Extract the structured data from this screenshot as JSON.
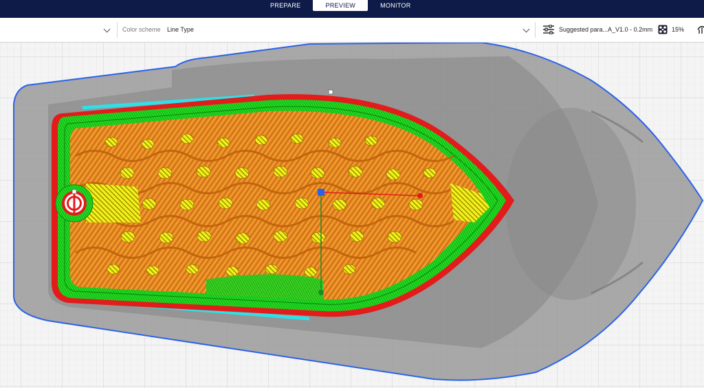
{
  "stage_tabs": {
    "prepare": "PREPARE",
    "preview": "PREVIEW",
    "monitor": "MONITOR"
  },
  "toolbar": {
    "color_scheme_label": "Color scheme",
    "color_scheme_value": "Line Type",
    "print_settings": "Suggested para...A_V1.0 - 0.2mm",
    "infill": "15%"
  },
  "colors": {
    "header": "#0e1b48",
    "wall_outer": "#e31b1b",
    "wall_inner": "#22dd22",
    "infill": "#f08a1c",
    "skin": "#f5ef1a",
    "support": "#2ee0e8",
    "shell": "#9a9a9a",
    "selection": "#2b62e8"
  },
  "icons": [
    "settings-sliders-icon",
    "infill-icon",
    "support-icon",
    "chevron-down-icon"
  ]
}
